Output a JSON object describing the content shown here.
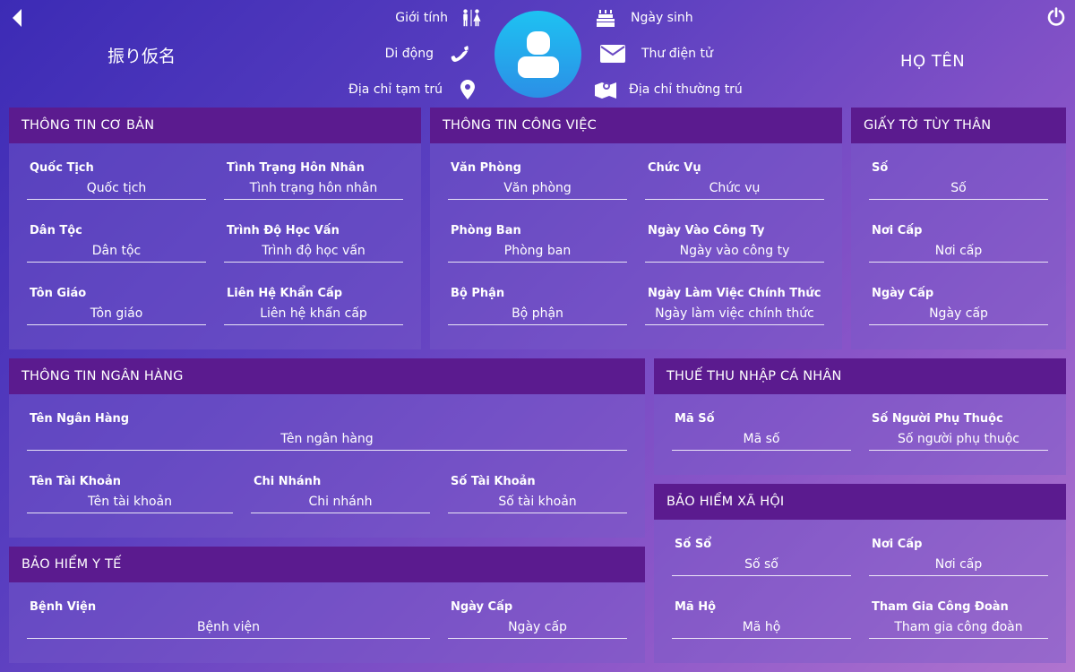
{
  "header": {
    "furigana": "振り仮名",
    "full_name": "HỌ TÊN",
    "gender_label": "Giới tính",
    "mobile_label": "Di động",
    "temp_address_label": "Địa chỉ tạm trú",
    "birthday_label": "Ngày sinh",
    "email_label": "Thư điện tử",
    "permanent_address_label": "Địa chỉ thường trú"
  },
  "icons": {
    "back": "chevron-left-icon",
    "power": "power-icon",
    "avatar": "user-icon",
    "gender": "restroom-icon",
    "mobile": "phone-icon",
    "temp_address": "map-marker-icon",
    "birthday": "birthday-cake-icon",
    "email": "envelope-icon",
    "permanent_address": "map-icon"
  },
  "colors": {
    "card_header": "#5b1b8f",
    "avatar_top": "#1ec2f2",
    "avatar_bottom": "#2b8fe6"
  },
  "basic": {
    "title": "THÔNG TIN CƠ BẢN",
    "nationality": {
      "label": "Quốc Tịch",
      "placeholder": "Quốc tịch"
    },
    "marital": {
      "label": "Tình Trạng Hôn Nhân",
      "placeholder": "Tình trạng hôn nhân"
    },
    "ethnicity": {
      "label": "Dân Tộc",
      "placeholder": "Dân tộc"
    },
    "education": {
      "label": "Trình Độ Học Vấn",
      "placeholder": "Trình độ học vấn"
    },
    "religion": {
      "label": "Tôn Giáo",
      "placeholder": "Tôn giáo"
    },
    "emergency": {
      "label": "Liên Hệ Khẩn Cấp",
      "placeholder": "Liên hệ khẩn cấp"
    }
  },
  "work": {
    "title": "THÔNG TIN CÔNG VIỆC",
    "office": {
      "label": "Văn Phòng",
      "placeholder": "Văn phòng"
    },
    "position": {
      "label": "Chức Vụ",
      "placeholder": "Chức vụ"
    },
    "department": {
      "label": "Phòng Ban",
      "placeholder": "Phòng ban"
    },
    "join_date": {
      "label": "Ngày Vào Công Ty",
      "placeholder": "Ngày vào công ty"
    },
    "division": {
      "label": "Bộ Phận",
      "placeholder": "Bộ phận"
    },
    "official_date": {
      "label": "Ngày Làm Việc Chính Thức",
      "placeholder": "Ngày làm việc chính thức"
    }
  },
  "idcard": {
    "title": "GIẤY TỜ TÙY THÂN",
    "number": {
      "label": "Số",
      "placeholder": "Số"
    },
    "issue_place": {
      "label": "Nơi Cấp",
      "placeholder": "Nơi cấp"
    },
    "issue_date": {
      "label": "Ngày Cấp",
      "placeholder": "Ngày cấp"
    }
  },
  "bank": {
    "title": "THÔNG TIN NGÂN HÀNG",
    "bank_name": {
      "label": "Tên Ngân Hàng",
      "placeholder": "Tên ngân hàng"
    },
    "account_name": {
      "label": "Tên Tài Khoản",
      "placeholder": "Tên tài khoản"
    },
    "branch": {
      "label": "Chi Nhánh",
      "placeholder": "Chi nhánh"
    },
    "account_number": {
      "label": "Số Tài Khoản",
      "placeholder": "Số tài khoản"
    }
  },
  "tax": {
    "title": "THUẾ THU NHẬP CÁ NHÂN",
    "code": {
      "label": "Mã Số",
      "placeholder": "Mã số"
    },
    "dependents": {
      "label": "Số Người Phụ Thuộc",
      "placeholder": "Số người phụ thuộc"
    }
  },
  "health": {
    "title": "BẢO HIỂM Y TẾ",
    "hospital": {
      "label": "Bệnh Viện",
      "placeholder": "Bệnh viện"
    },
    "issue_date": {
      "label": "Ngày Cấp",
      "placeholder": "Ngày cấp"
    }
  },
  "social": {
    "title": "BẢO HIỂM XÃ HỘI",
    "book_number": {
      "label": "Số Sổ",
      "placeholder": "Số sổ"
    },
    "issue_place": {
      "label": "Nơi Cấp",
      "placeholder": "Nơi cấp"
    },
    "household_code": {
      "label": "Mã Hộ",
      "placeholder": "Mã hộ"
    },
    "union": {
      "label": "Tham Gia Công Đoàn",
      "placeholder": "Tham gia công đoàn"
    }
  }
}
